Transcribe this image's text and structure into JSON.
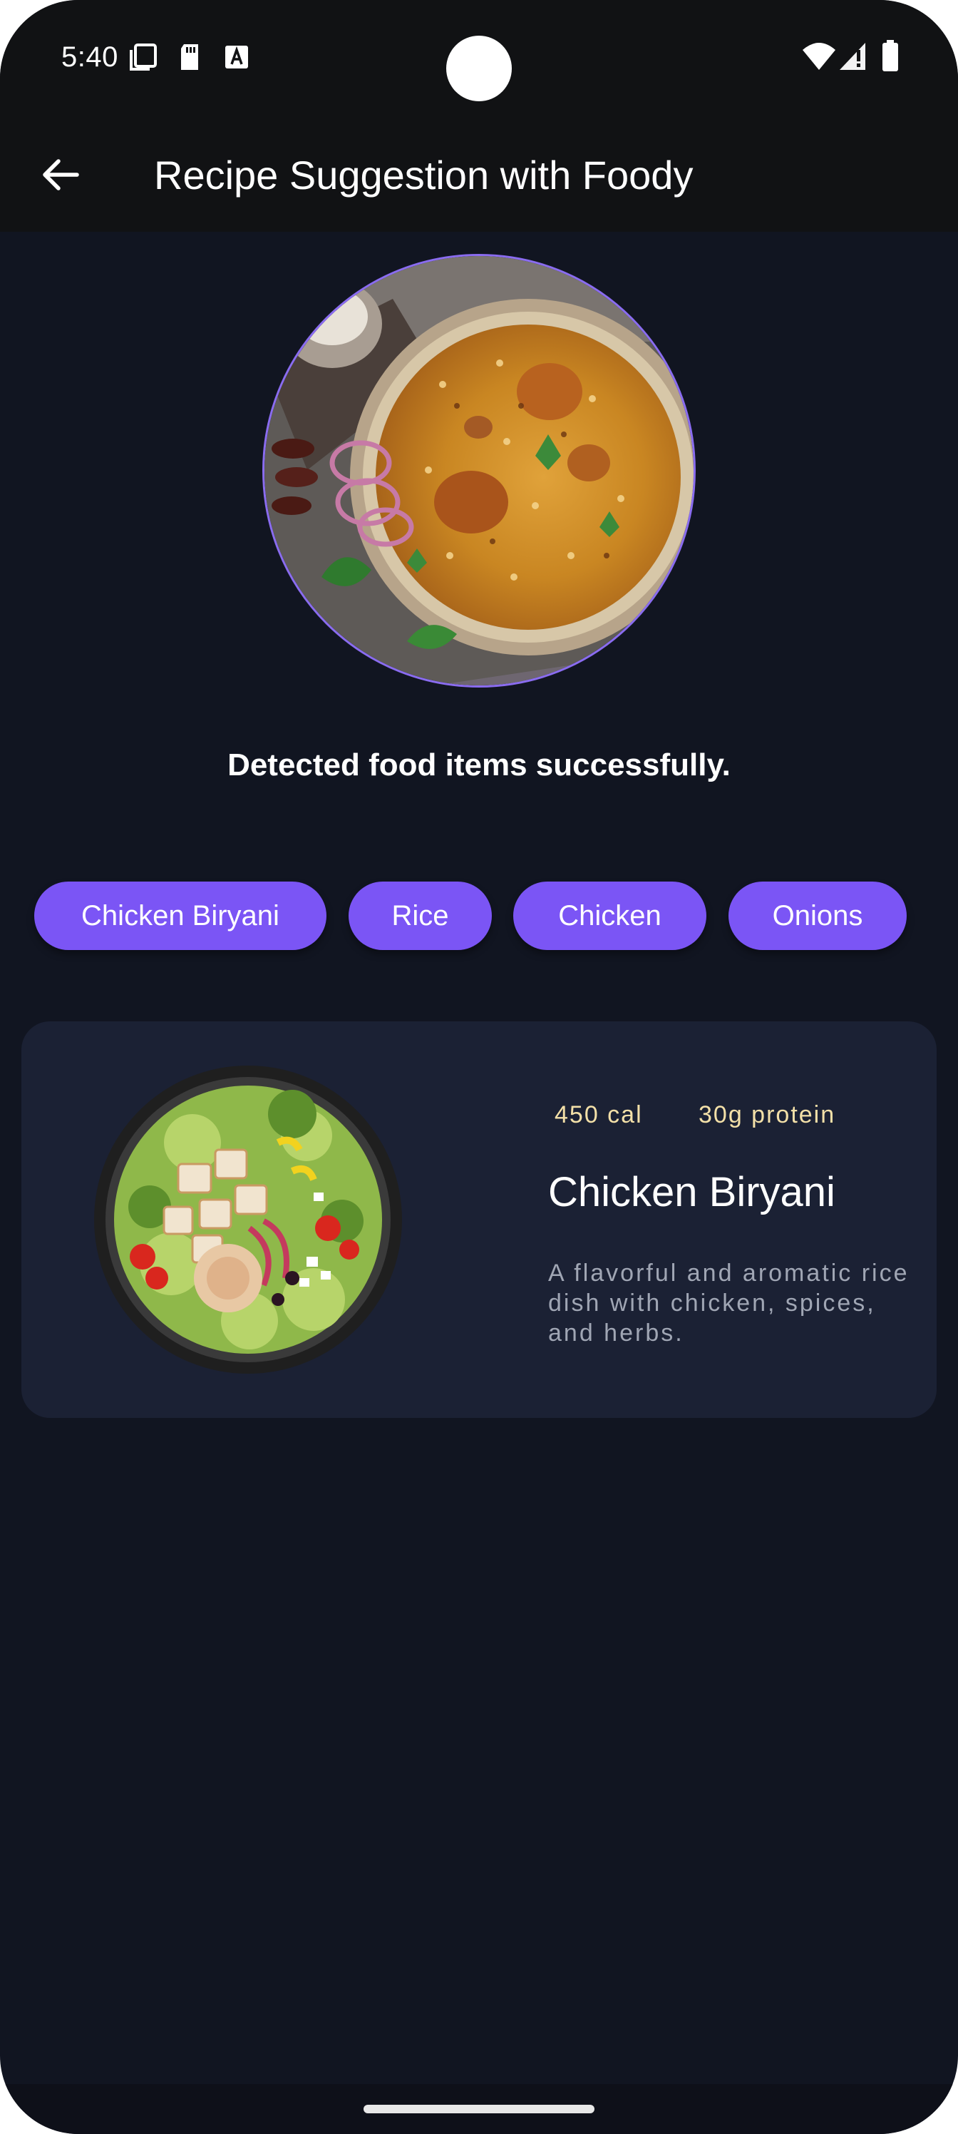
{
  "status_bar": {
    "time": "5:40"
  },
  "app_bar": {
    "title": "Recipe Suggestion with Foody"
  },
  "detection": {
    "message": "Detected food items successfully."
  },
  "chips": [
    {
      "label": "Chicken Biryani"
    },
    {
      "label": "Rice"
    },
    {
      "label": "Chicken"
    },
    {
      "label": "Onions"
    }
  ],
  "recipe_card": {
    "calories": "450 cal",
    "protein": "30g protein",
    "title": "Chicken Biryani",
    "description": "A flavorful and aromatic rice dish with chicken, spices, and herbs."
  },
  "colors": {
    "background": "#111521",
    "app_bar": "#111214",
    "chip": "#7b55f5",
    "card": "#1b2134",
    "meta_text": "#f3e0a8",
    "accent_ring": "#8a6cf0"
  },
  "icons": {
    "back": "arrow-back-icon",
    "wifi": "wifi-icon",
    "signal": "signal-icon",
    "battery": "battery-icon"
  }
}
